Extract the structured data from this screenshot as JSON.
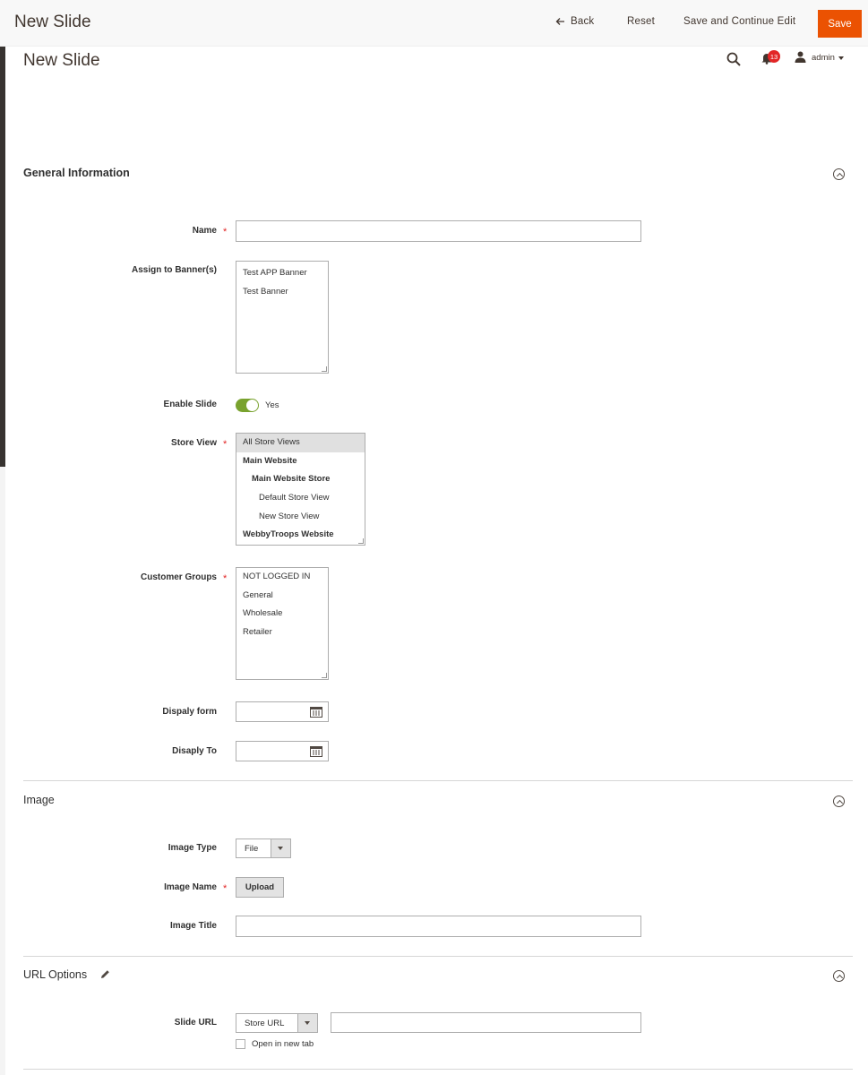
{
  "header": {
    "title": "New Slide",
    "back_label": "Back",
    "reset_label": "Reset",
    "save_continue_label": "Save and Continue Edit",
    "save_label": "Save"
  },
  "page": {
    "title": "New Slide",
    "notifications_count": "13",
    "user_name": "admin"
  },
  "general": {
    "title": "General Information",
    "name_label": "Name",
    "name_value": "",
    "banners_label": "Assign to Banner(s)",
    "banners_options": [
      "Test APP Banner",
      "Test Banner"
    ],
    "enable_label": "Enable Slide",
    "enable_value": "Yes",
    "store_view_label": "Store View",
    "store_view_options": [
      "All Store Views",
      "Main Website",
      "Main Website Store",
      "Default Store View",
      "New Store View",
      "WebbyTroops Website"
    ],
    "customer_groups_label": "Customer Groups",
    "customer_groups_options": [
      "NOT LOGGED IN",
      "General",
      "Wholesale",
      "Retailer"
    ],
    "display_from_label": "Dispaly form",
    "display_to_label": "Disaply To"
  },
  "image": {
    "title": "Image",
    "type_label": "Image Type",
    "type_value": "File",
    "name_label": "Image Name",
    "upload_label": "Upload",
    "title_label": "Image Title",
    "title_value": ""
  },
  "url_options": {
    "title": "URL Options",
    "slide_url_label": "Slide URL",
    "url_type_value": "Store URL",
    "url_value": "",
    "new_tab_label": "Open in new tab"
  },
  "colors": {
    "accent": "#eb5202",
    "toggle_on": "#79a22e",
    "required": "#e22626",
    "badge": "#e22626"
  }
}
